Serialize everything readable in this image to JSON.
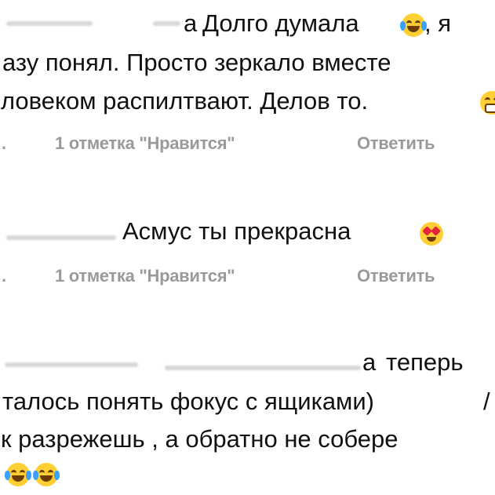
{
  "comments": [
    {
      "lines": [
        "Долго думала",
        ", я",
        "азу понял. Просто зеркало вместе",
        "ловеком распилтвают. Делов то."
      ],
      "fragment_a": "а",
      "meta_dot": ".",
      "likes": "1 отметка \"Нравится\"",
      "reply": "Ответить"
    },
    {
      "lines": [
        "Асмус ты прекрасна"
      ],
      "meta_dot": ".",
      "likes": "1 отметка \"Нравится\"",
      "reply": "Ответить"
    },
    {
      "lines": [
        "теперь",
        "талось понять фокус с ящиками)",
        "к разрежешь , а обратно не собере"
      ],
      "fragment_a": "а",
      "trailing": "/"
    }
  ],
  "icons": {
    "laugh": "face-with-tears-of-joy-icon",
    "heart_eyes": "smiling-face-with-heart-eyes-icon",
    "grimace": "grimacing-face-icon"
  }
}
